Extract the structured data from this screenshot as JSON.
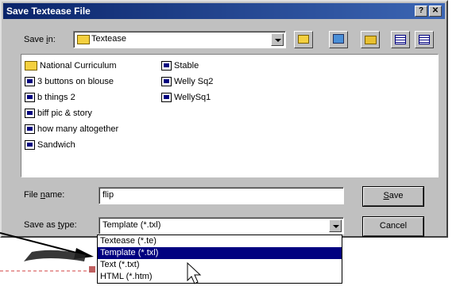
{
  "dialog": {
    "title": "Save Textease File",
    "help_btn": "?",
    "close_btn": "✕"
  },
  "save_in": {
    "label_pre": "Save ",
    "label_u": "i",
    "label_post": "n:",
    "value": "Textease"
  },
  "files": {
    "col1": [
      {
        "name": "National Curriculum",
        "icon": "folder-icon"
      },
      {
        "name": "3 buttons on blouse",
        "icon": "document-icon"
      },
      {
        "name": "b things 2",
        "icon": "document-icon"
      },
      {
        "name": "biff pic & story",
        "icon": "document-icon"
      },
      {
        "name": "how many altogether",
        "icon": "document-icon"
      },
      {
        "name": "Sandwich",
        "icon": "document-icon"
      }
    ],
    "col2": [
      {
        "name": "Stable",
        "icon": "document-icon"
      },
      {
        "name": "Welly Sq2",
        "icon": "document-icon"
      },
      {
        "name": "WellySq1",
        "icon": "document-icon"
      }
    ]
  },
  "filename": {
    "label_pre": "File ",
    "label_u": "n",
    "label_post": "ame:",
    "value": "flip"
  },
  "savetype": {
    "label_pre": "Save as ",
    "label_u": "t",
    "label_post": "ype:",
    "value": "Template (*.txl)",
    "options": [
      "Textease (*.te)",
      "Template (*.txl)",
      "Text (*.txt)",
      "HTML (*.htm)"
    ],
    "selected_index": 1
  },
  "buttons": {
    "save_u": "S",
    "save_rest": "ave",
    "cancel": "Cancel"
  }
}
